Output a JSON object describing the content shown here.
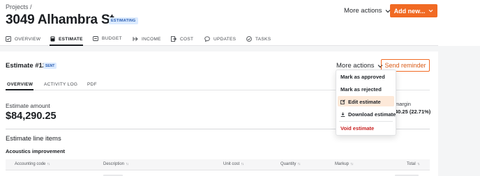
{
  "header": {
    "breadcrumb": "Projects /",
    "title": "3049 Alhambra St",
    "status": "ESTIMATING",
    "more_actions": "More actions",
    "add_new": "Add new..."
  },
  "project_tabs": [
    {
      "label": "OVERVIEW",
      "icon": "checklist-icon",
      "active": false
    },
    {
      "label": "ESTIMATE",
      "icon": "calculator-icon",
      "active": true
    },
    {
      "label": "BUDGET",
      "icon": "budget-icon",
      "active": false
    },
    {
      "label": "INCOME",
      "icon": "income-icon",
      "active": false
    },
    {
      "label": "COST",
      "icon": "cost-icon",
      "active": false
    },
    {
      "label": "UPDATES",
      "icon": "chat-bubble-icon",
      "active": false
    },
    {
      "label": "TASKS",
      "icon": "check-circle-icon",
      "active": false
    }
  ],
  "estimate": {
    "title": "Estimate #12",
    "status": "SENT",
    "more_actions": "More actions",
    "send_reminder": "Send reminder",
    "tabs": [
      {
        "label": "OVERVIEW",
        "active": true
      },
      {
        "label": "ACTIVITY LOG",
        "active": false
      },
      {
        "label": "PDF",
        "active": false
      }
    ],
    "amount_label": "Estimate amount",
    "amount_value": "$84,290.25",
    "margin_label": "margin",
    "margin_value": "40.25 (22.71%)",
    "line_items_heading": "Estimate line items",
    "group_title": "Acoustics improvement",
    "columns": [
      "Accounting code",
      "Description",
      "Unit cost",
      "Quantity",
      "Markup",
      "Total"
    ]
  },
  "dropdown": {
    "items": [
      {
        "label": "Mark as approved",
        "icon": null
      },
      {
        "label": "Mark as rejected",
        "icon": null
      },
      {
        "label": "Edit estimate",
        "icon": "edit-icon",
        "highlighted": true
      },
      {
        "label": "Download estimate",
        "icon": "download-icon"
      },
      {
        "label": "Void estimate",
        "icon": null,
        "danger": true
      }
    ]
  },
  "colors": {
    "accent": "#f16a23",
    "badge_bg": "#dcebff",
    "badge_text": "#2b5fb3",
    "danger": "#c81e1e",
    "highlight": "#fde9d9"
  }
}
